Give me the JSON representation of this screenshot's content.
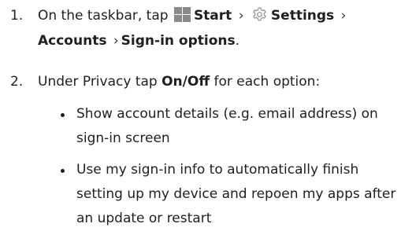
{
  "steps": [
    {
      "number": "1.",
      "text_before": "On the taskbar, tap",
      "start_label": "Start",
      "separator": "›",
      "settings_label": "Settings",
      "accounts_label": "Accounts",
      "signin_label": "Sign-in options",
      "end": "."
    },
    {
      "number": "2.",
      "text_before": "Under Privacy tap",
      "toggle_label": "On/Off",
      "text_after": "for each option:"
    }
  ],
  "bullets": [
    "Show account details (e.g. email address) on sign-in screen",
    "Use my sign-in info to automatically finish setting up my device and repoen my apps after an update or restart"
  ],
  "icons": {
    "start": "windows-start-icon",
    "settings": "gear-icon"
  },
  "colors": {
    "text": "#1f1f1f",
    "icon": "#8a8a8a"
  }
}
